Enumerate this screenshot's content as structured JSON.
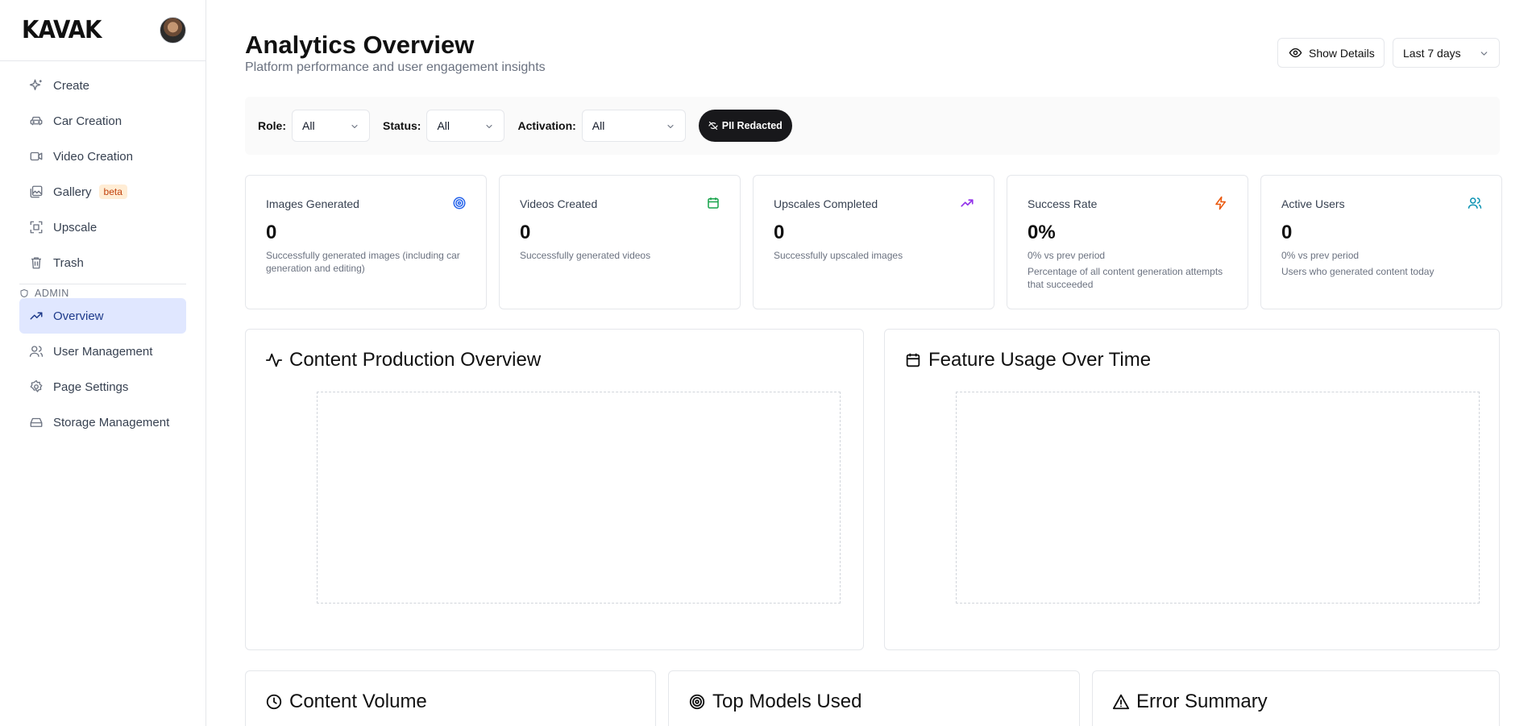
{
  "brand": {
    "logo": "KAVAK"
  },
  "sidebar": {
    "items": [
      {
        "label": "Create",
        "icon": "sparkles-icon"
      },
      {
        "label": "Car Creation",
        "icon": "car-icon"
      },
      {
        "label": "Video Creation",
        "icon": "video-icon"
      },
      {
        "label": "Gallery",
        "icon": "gallery-icon",
        "badge": "beta"
      },
      {
        "label": "Upscale",
        "icon": "upscale-icon"
      },
      {
        "label": "Trash",
        "icon": "trash-icon"
      }
    ],
    "admin_label": "ADMIN",
    "admin_items": [
      {
        "label": "Overview",
        "icon": "trending-up-icon",
        "active": true
      },
      {
        "label": "User Management",
        "icon": "users-icon"
      },
      {
        "label": "Page Settings",
        "icon": "gear-icon"
      },
      {
        "label": "Storage Management",
        "icon": "storage-icon"
      }
    ]
  },
  "header": {
    "title": "Analytics Overview",
    "subtitle": "Platform performance and user engagement insights",
    "show_details": "Show Details",
    "range": "Last 7 days"
  },
  "filters": {
    "role_label": "Role:",
    "role_value": "All",
    "status_label": "Status:",
    "status_value": "All",
    "activation_label": "Activation:",
    "activation_value": "All",
    "pii": "PII Redacted"
  },
  "stats": [
    {
      "title": "Images Generated",
      "value": "0",
      "desc": "Successfully generated images (including car generation and editing)",
      "icon": "target-icon",
      "color": "#2563eb"
    },
    {
      "title": "Videos Created",
      "value": "0",
      "desc": "Successfully generated videos",
      "icon": "calendar-icon",
      "color": "#16a34a"
    },
    {
      "title": "Upscales Completed",
      "value": "0",
      "desc": "Successfully upscaled images",
      "icon": "trending-up-icon",
      "color": "#9333ea"
    },
    {
      "title": "Success Rate",
      "value": "0%",
      "sub": "0% vs prev period",
      "desc": "Percentage of all content generation attempts that succeeded",
      "icon": "zap-icon",
      "color": "#ea580c"
    },
    {
      "title": "Active Users",
      "value": "0",
      "sub": "0% vs prev period",
      "desc": "Users who generated content today",
      "icon": "users-icon",
      "color": "#0891b2"
    }
  ],
  "panels": {
    "content_production": "Content Production Overview",
    "feature_usage": "Feature Usage Over Time",
    "content_volume": "Content Volume",
    "top_models": "Top Models Used",
    "error_summary": "Error Summary"
  }
}
